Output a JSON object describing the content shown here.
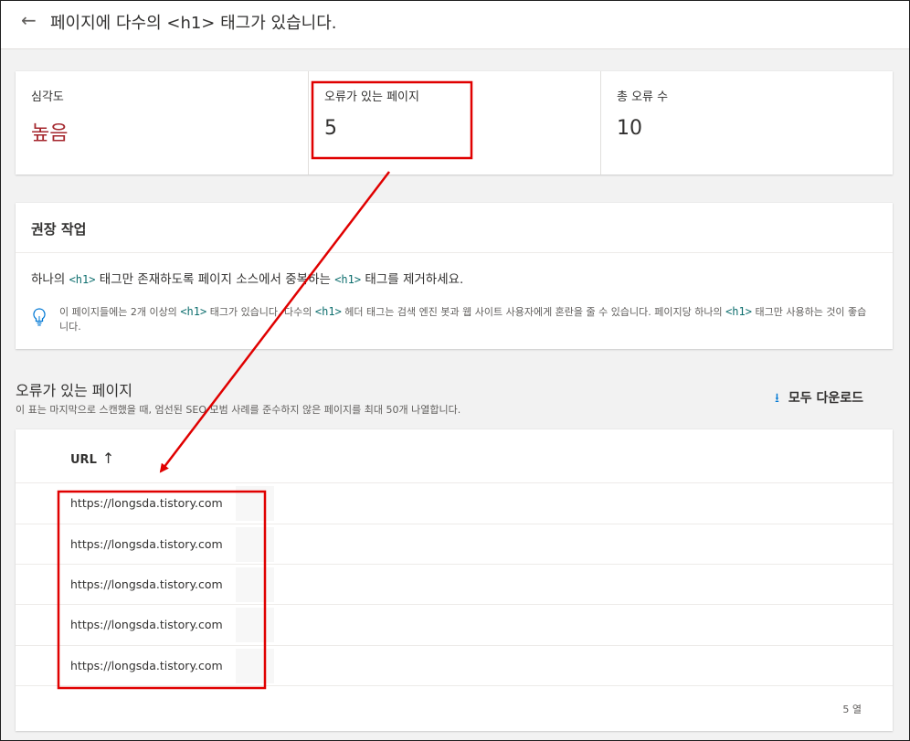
{
  "header": {
    "back_icon": "back-arrow-icon",
    "title": "페이지에 다수의 <h1> 태그가 있습니다."
  },
  "metrics": [
    {
      "label": "심각도",
      "value": "높음"
    },
    {
      "label": "오류가 있는 페이지",
      "value": "5"
    },
    {
      "label": "총 오류 수",
      "value": "10"
    }
  ],
  "recommendation": {
    "title": "권장 작업",
    "main": {
      "p1": "하나의 ",
      "c1": "<h1>",
      "p2": " 태그만 존재하도록 페이지 소스에서 중복하는 ",
      "c2": "<h1>",
      "p3": " 태그를 제거하세요."
    },
    "tip_icon": "lightbulb-icon",
    "tip": {
      "p1": "이 페이지들에는 2개 이상의 ",
      "c1": "<h1>",
      "p2": " 태그가 있습니다. 다수의 ",
      "c2": "<h1>",
      "p3": " 헤더 태그는 검색 엔진 봇과 웹 사이트 사용자에게 혼란을 줄 수 있습니다. 페이지당 하나의 ",
      "c3": "<h1>",
      "p4": " 태그만 사용하는 것이 좋습니다."
    }
  },
  "pages_section": {
    "title": "오류가 있는 페이지",
    "description": "이 표는 마지막으로 스캔했을 때, 엄선된 SEO 모범 사례를 준수하지 않은 페이지를 최대 50개 나열합니다.",
    "download_icon": "download-icon",
    "download_label": "모두 다운로드"
  },
  "table": {
    "column": "URL",
    "sort_icon": "↑",
    "rows": [
      "https://longsda.tistory.com",
      "https://longsda.tistory.com",
      "https://longsda.tistory.com",
      "https://longsda.tistory.com",
      "https://longsda.tistory.com"
    ],
    "row_count": "5 열"
  },
  "colors": {
    "severity_high": "#a4262c",
    "annotation_red": "#e00000",
    "accent": "#0078d4",
    "code": "#0e6e6e"
  }
}
